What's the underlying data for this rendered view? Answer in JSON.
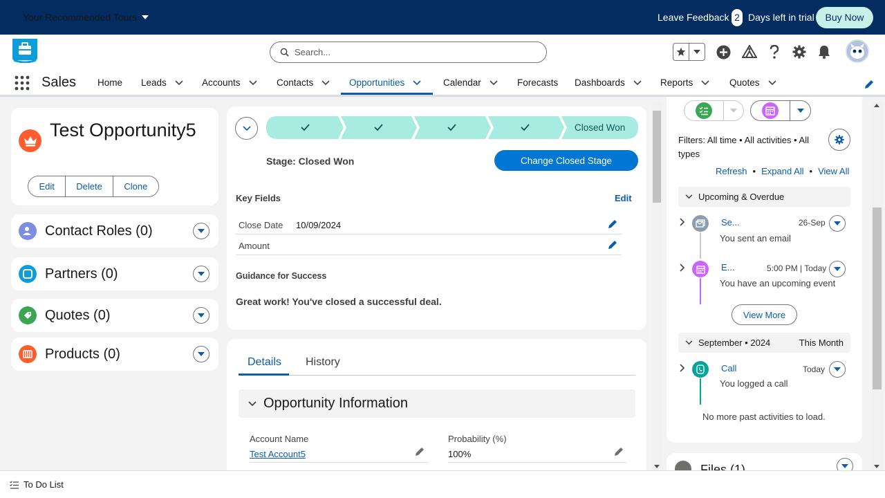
{
  "banner": {
    "tours_label": "Your Recommended Tours",
    "feedback_label": "Leave Feedback",
    "trial_days": "2",
    "trial_text": "Days left in trial",
    "buy_now_label": "Buy Now"
  },
  "header": {
    "search_placeholder": "Search..."
  },
  "nav": {
    "app_name": "Sales",
    "items": [
      {
        "label": "Home"
      },
      {
        "label": "Leads"
      },
      {
        "label": "Accounts"
      },
      {
        "label": "Contacts"
      },
      {
        "label": "Opportunities"
      },
      {
        "label": "Calendar"
      },
      {
        "label": "Forecasts"
      },
      {
        "label": "Dashboards"
      },
      {
        "label": "Reports"
      },
      {
        "label": "Quotes"
      }
    ],
    "active": "Opportunities"
  },
  "record": {
    "title": "Test Opportunity5",
    "actions": [
      "Edit",
      "Delete",
      "Clone"
    ]
  },
  "related": [
    {
      "label": "Contact Roles (0)",
      "icon": "contact-roles-icon",
      "color": "#7f8de1"
    },
    {
      "label": "Partners (0)",
      "icon": "partners-icon",
      "color": "#0d9dda"
    },
    {
      "label": "Quotes (0)",
      "icon": "quotes-icon",
      "color": "#3ba755"
    },
    {
      "label": "Products (0)",
      "icon": "products-icon",
      "color": "#ff5d2d"
    }
  ],
  "path": {
    "final_stage": "Closed Won",
    "stage_label": "Stage: Closed Won",
    "change_button": "Change Closed Stage",
    "key_fields_title": "Key Fields",
    "key_fields_edit": "Edit",
    "fields": [
      {
        "label": "Close Date",
        "value": "10/09/2024"
      },
      {
        "label": "Amount",
        "value": ""
      }
    ],
    "guidance_title": "Guidance for Success",
    "guidance_text": "Great work! You've closed a successful deal."
  },
  "details": {
    "tabs": [
      "Details",
      "History"
    ],
    "section_title": "Opportunity Information",
    "account_name_label": "Account Name",
    "account_name_value": "Test Account5",
    "probability_label": "Probability (%)",
    "probability_value": "100%"
  },
  "activity": {
    "filters_text": "Filters: All time • All activities • All types",
    "links": [
      "Refresh",
      "Expand All",
      "View All"
    ],
    "upcoming_title": "Upcoming & Overdue",
    "items": [
      {
        "title": "Se...",
        "date": "26-Sep",
        "desc": "You sent an email",
        "icon": "email-icon",
        "color": "#8a9eab"
      },
      {
        "title": "E...",
        "date": "5:00 PM | Today",
        "desc": "You have an upcoming event",
        "icon": "event-icon",
        "color": "#cb65ff"
      }
    ],
    "view_more": "View More",
    "month_title": "September • 2024",
    "month_right": "This Month",
    "past_items": [
      {
        "title": "Call",
        "date": "Today",
        "desc": "You logged a call",
        "icon": "call-icon",
        "color": "#06a59a"
      }
    ],
    "no_more": "No more past activities to load."
  },
  "files": {
    "label": "Files (1)"
  },
  "footer": {
    "todo_label": "To Do List"
  },
  "colors": {
    "brand_dark": "#032d60",
    "link_blue": "#0b5cab",
    "primary_button": "#0176d3",
    "path_complete": "#a8ebe0",
    "opportunity_icon": "#ff5d2d"
  }
}
